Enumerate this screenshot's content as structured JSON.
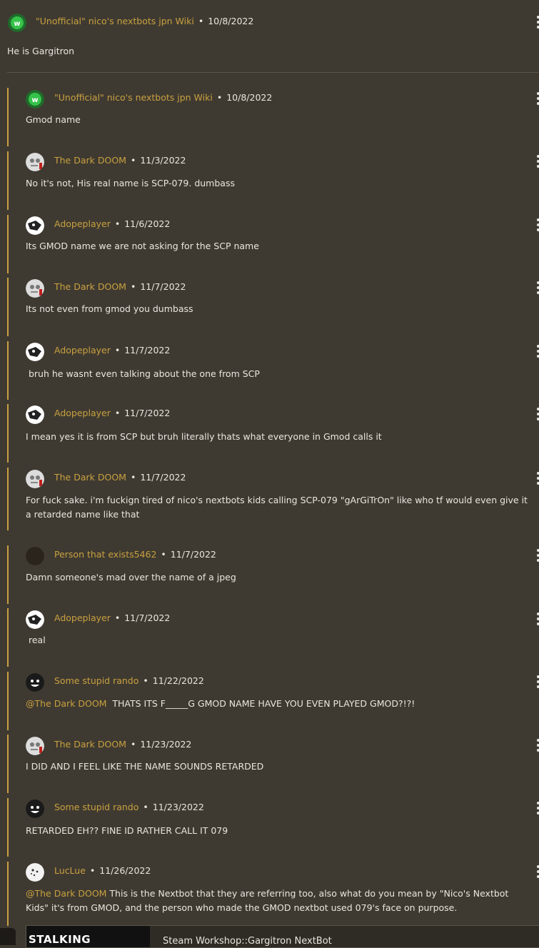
{
  "top_comment": {
    "author": "\"Unofficial\" nico's nextbots jpn Wiki",
    "separator": "•",
    "date": "10/8/2022",
    "text": "He is Gargitron"
  },
  "replies": [
    {
      "author": "\"Unofficial\" nico's nextbots jpn Wiki",
      "date": "10/8/2022",
      "text": "Gmod name",
      "avatar": "wiki-logo"
    },
    {
      "author": "The Dark DOOM",
      "date": "11/3/2022",
      "text": "No it's not, His real name is SCP-079. dumbass",
      "avatar": "doom"
    },
    {
      "author": "Adopeplayer",
      "date": "11/6/2022",
      "text": "Its GMOD name we are not asking for the SCP name",
      "avatar": "adope"
    },
    {
      "author": "The Dark DOOM",
      "date": "11/7/2022",
      "text": "Its not even from gmod you dumbass",
      "avatar": "doom"
    },
    {
      "author": "Adopeplayer",
      "date": "11/7/2022",
      "text": " bruh he wasnt even talking about the one from SCP",
      "avatar": "adope"
    },
    {
      "author": "Adopeplayer",
      "date": "11/7/2022",
      "text": "I mean yes it is from SCP but bruh literally thats what everyone in Gmod calls it",
      "avatar": "adope"
    },
    {
      "author": "The Dark DOOM",
      "date": "11/7/2022",
      "text": "For fuck sake. i'm fuckign tired of nico's nextbots kids calling SCP-079 \"gArGiTrOn\" like who tf would even give it a retarded name like that",
      "avatar": "doom"
    },
    {
      "author": "Person that exists5462",
      "date": "11/7/2022",
      "text": "Damn someone's mad over the name of a jpeg",
      "avatar": "plain"
    },
    {
      "author": "Adopeplayer",
      "date": "11/7/2022",
      "text": " real",
      "avatar": "adope"
    },
    {
      "author": "Some stupid rando",
      "date": "11/22/2022",
      "mention": "@The Dark DOOM",
      "text": "  THATS ITS F_____G GMOD NAME HAVE YOU EVEN PLAYED GMOD?!?!",
      "avatar": "rando"
    },
    {
      "author": "The Dark DOOM",
      "date": "11/23/2022",
      "text": "I DID AND I FEEL LIKE THE NAME SOUNDS RETARDED",
      "avatar": "doom"
    },
    {
      "author": "Some stupid rando",
      "date": "11/23/2022",
      "text": "RETARDED EH?? FINE ID RATHER CALL IT 079",
      "avatar": "rando"
    },
    {
      "author": "LucLue",
      "date": "11/26/2022",
      "mention": "@The Dark DOOM",
      "text": " This is the Nextbot that they are referring too, also what do you mean by \"Nico's Nextbot Kids\" it's from GMOD, and the person who made the GMOD nextbot used 079's face on purpose.",
      "avatar": "luc"
    }
  ],
  "embed": {
    "thumb_text": "STALKING NEXTBOT",
    "title": "Steam Workshop::Gargitron NextBot"
  },
  "colors": {
    "background": "#3f3a31",
    "accent": "#c8a040",
    "text": "#e9e6df",
    "divider": "#5a5448"
  }
}
